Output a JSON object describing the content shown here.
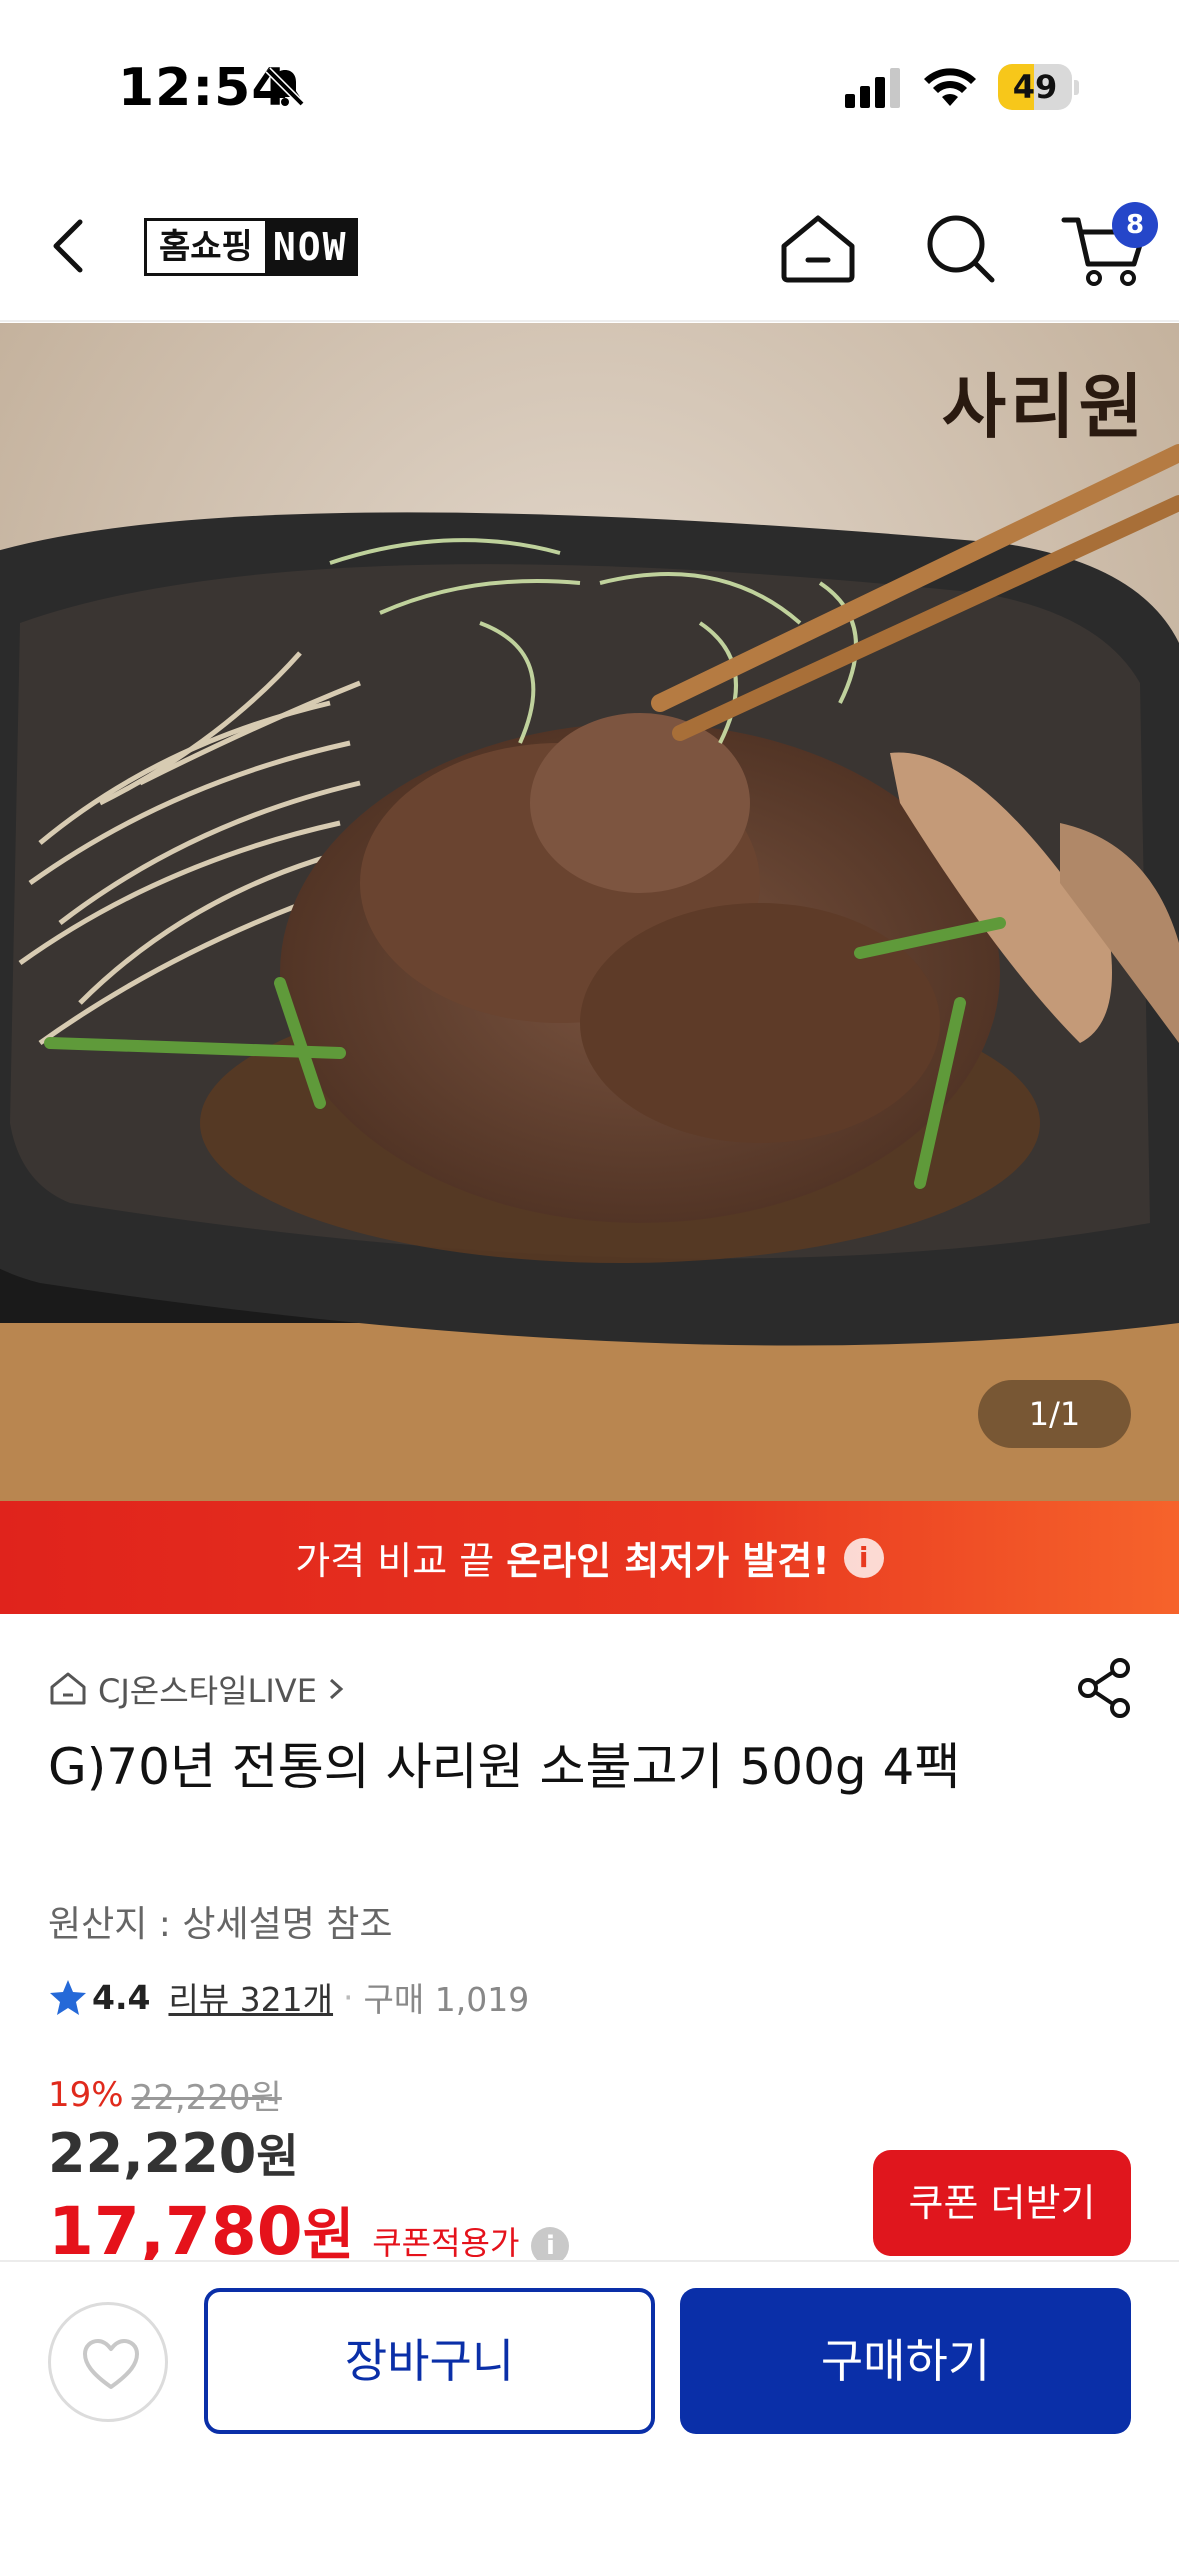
{
  "status_bar": {
    "time": "12:54",
    "battery": "49",
    "battery_level": 0.49
  },
  "header": {
    "logo_part1": "홈쇼핑",
    "logo_part2": "NOW",
    "cart_count": "8"
  },
  "hero": {
    "brand_mark": "사리원",
    "image_counter": "1/1"
  },
  "promo": {
    "text_light": "가격 비교 끝",
    "text_strong": "온라인 최저가 발견!",
    "info_glyph": "i"
  },
  "product": {
    "seller": "CJ온스타일LIVE",
    "title": "G)70년 전통의 사리원 소불고기 500g 4팩",
    "origin": "원산지 : 상세설명 참조",
    "rating": "4.4",
    "reviews": "리뷰 321개",
    "dot": "·",
    "purchases": "구매 1,019"
  },
  "price": {
    "discount_rate": "19%",
    "original_price": "22,220원",
    "price_amount": "22,220",
    "price_unit": "원",
    "sale_amount": "17,780",
    "sale_unit": "원",
    "coupon_label": "쿠폰적용가",
    "coupon_button": "쿠폰 더받기"
  },
  "bottom_bar": {
    "cart_button": "장바구니",
    "buy_button": "구매하기"
  },
  "colors": {
    "accent_blue": "#0a2fa8",
    "sale_red": "#e5121b",
    "promo_red": "#e0231c",
    "badge_blue": "#2546c9"
  }
}
